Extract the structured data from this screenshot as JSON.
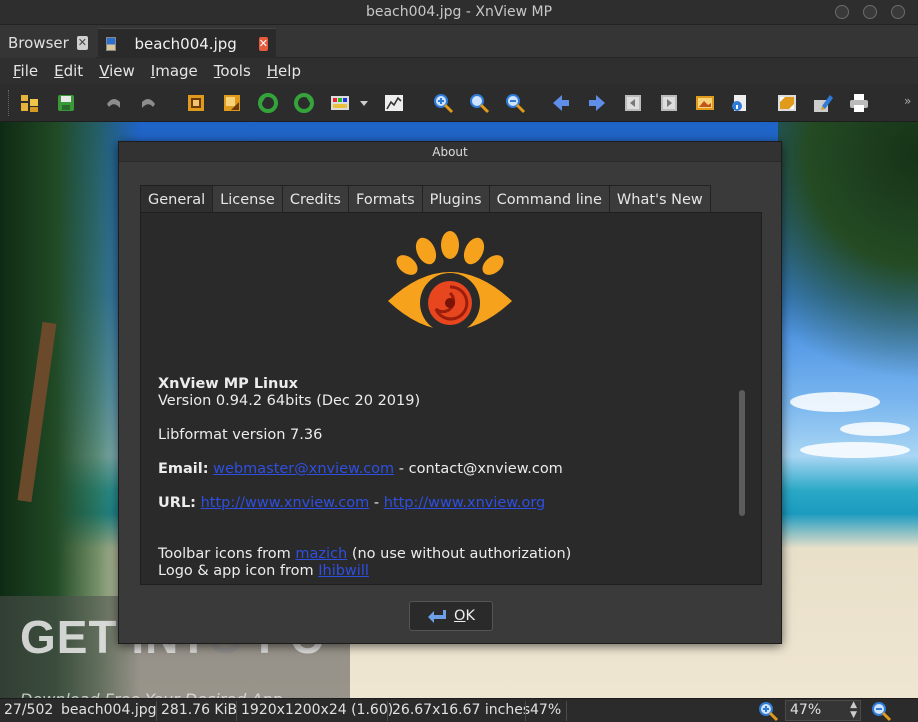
{
  "window": {
    "title": "beach004.jpg - XnView MP"
  },
  "tabs": [
    {
      "label": "Browser"
    },
    {
      "label": "beach004.jpg"
    }
  ],
  "menu": [
    {
      "label": "File",
      "mn": "F",
      "rest": "ile"
    },
    {
      "label": "Edit",
      "mn": "E",
      "rest": "dit"
    },
    {
      "label": "View",
      "mn": "V",
      "rest": "iew"
    },
    {
      "label": "Image",
      "mn": "I",
      "rest": "mage"
    },
    {
      "label": "Tools",
      "mn": "T",
      "rest": "ools"
    },
    {
      "label": "Help",
      "mn": "H",
      "rest": "elp"
    }
  ],
  "toolbar": {
    "icons": [
      "open-folder-icon",
      "save-icon",
      "undo-icon",
      "redo-icon",
      "crop-icon",
      "resize-icon",
      "rotate-left-icon",
      "rotate-right-icon",
      "adjust-colors-icon",
      "dropdown-arrow-icon",
      "histogram-icon",
      "zoom-in-icon",
      "zoom-fit-icon",
      "zoom-out-icon",
      "previous-icon",
      "next-icon",
      "first-page-icon",
      "last-page-icon",
      "slideshow-icon",
      "info-icon",
      "fullscreen-icon",
      "edit-icon",
      "print-icon"
    ],
    "overflow": "»",
    "colors": {
      "accent": "#2f7cd8",
      "green": "#33a33a",
      "orange": "#e09a1c"
    }
  },
  "dialog": {
    "title": "About",
    "tabs": [
      "General",
      "License",
      "Credits",
      "Formats",
      "Plugins",
      "Command line",
      "What's New"
    ],
    "active_tab": "General",
    "product": "XnView MP Linux",
    "version": "Version 0.94.2 64bits (Dec 20 2019)",
    "libformat": "Libformat version 7.36",
    "email_label": "Email:",
    "email_link": "webmaster@xnview.com",
    "email_sep": " - ",
    "email_contact": "contact@xnview.com",
    "url_label": "URL:",
    "url_1": "http://www.xnview.com",
    "url_sep": " - ",
    "url_2": "http://www.xnview.org",
    "toolbar_credit_pre": "Toolbar icons from ",
    "toolbar_credit_link": "mazich",
    "toolbar_credit_post": " (no use without authorization)",
    "logo_credit_pre": "Logo & app icon from ",
    "logo_credit_link": "Ihibwill",
    "ok": "OK",
    "ok_mn": "O",
    "ok_rest": "K",
    "logo_colors": {
      "outer": "#f6a21c",
      "ring": "#2a2a2a",
      "inner": "#e7461e"
    }
  },
  "watermark": {
    "pre": "GET ",
    "mid1": "INT",
    "o": "O",
    "mid2": " PC",
    "sub": "Download Free Your Desired App"
  },
  "status": {
    "index": "27/502",
    "file": "beach004.jpg",
    "size": "281.76 KiB",
    "dims": "1920x1200x24 (1.60)",
    "inches": "26.67x16.67 inches",
    "zoom_pct": "47%",
    "zoom_value": "47%"
  }
}
